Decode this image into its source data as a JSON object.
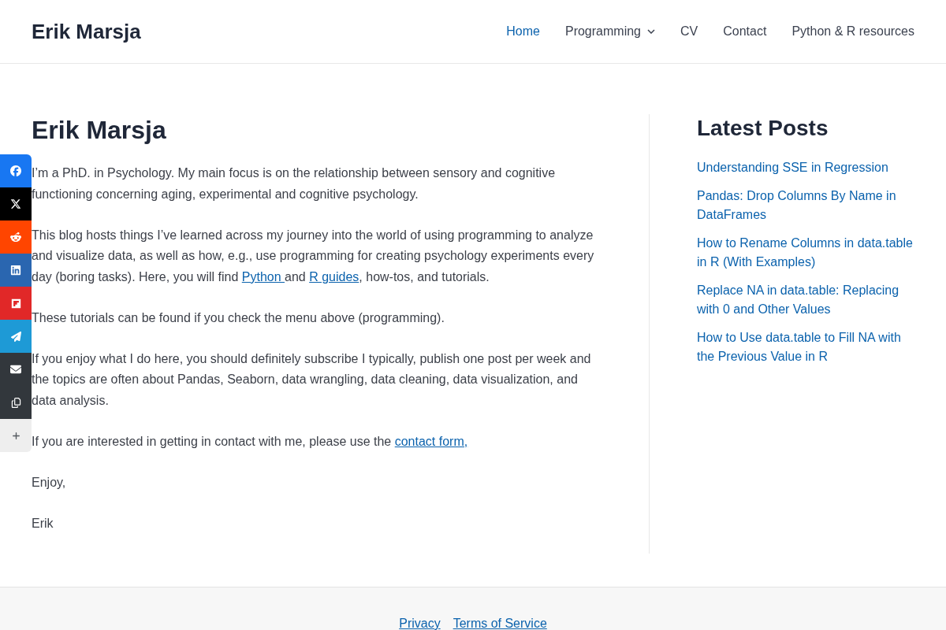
{
  "site_title": "Erik Marsja",
  "nav": [
    {
      "label": "Home",
      "selected": true,
      "has_submenu": false
    },
    {
      "label": "Programming",
      "selected": false,
      "has_submenu": true
    },
    {
      "label": "CV",
      "selected": false,
      "has_submenu": false
    },
    {
      "label": "Contact",
      "selected": false,
      "has_submenu": false
    },
    {
      "label": "Python & R resources",
      "selected": false,
      "has_submenu": false
    }
  ],
  "share_buttons": [
    {
      "kind": "facebook",
      "color": "#1877f2"
    },
    {
      "kind": "x",
      "color": "#000000"
    },
    {
      "kind": "reddit",
      "color": "#ff4500"
    },
    {
      "kind": "linkedin",
      "color": "#2a66b0"
    },
    {
      "kind": "flipboard",
      "color": "#e12828"
    },
    {
      "kind": "telegram",
      "color": "#1e9ad6"
    },
    {
      "kind": "email",
      "color": "#32373c"
    },
    {
      "kind": "copy",
      "color": "#32373c"
    },
    {
      "kind": "more",
      "color": "#eeeeee"
    }
  ],
  "page": {
    "title": "Erik Marsja",
    "paragraphs": [
      [
        {
          "kind": "text",
          "text": "I’m a PhD. in Psychology. My main focus is on the relationship between sensory and cognitive functioning concerning aging, experimental and cognitive psychology."
        }
      ],
      [
        {
          "kind": "text",
          "text": "This blog hosts things I’ve learned across my journey into the world of using programming to analyze and visualize data, as well as how, e.g., use programming for creating psychology experiments every day (boring tasks). Here, you will find "
        },
        {
          "kind": "link",
          "text": "Python "
        },
        {
          "kind": "text",
          "text": "and "
        },
        {
          "kind": "link",
          "text": "R guides"
        },
        {
          "kind": "text",
          "text": ", how-tos, and tutorials."
        }
      ],
      [
        {
          "kind": "text",
          "text": "These tutorials can be found if you check the menu above (programming)."
        }
      ],
      [
        {
          "kind": "text",
          "text": "If you enjoy what I do here, you should definitely subscribe I typically, publish one post per week and the topics are often about Pandas, Seaborn, data wrangling, data cleaning, data visualization, and data analysis."
        }
      ],
      [
        {
          "kind": "text",
          "text": "If you are interested in getting in contact with me, please use the "
        },
        {
          "kind": "link",
          "text": "contact form,"
        }
      ],
      [
        {
          "kind": "text",
          "text": "Enjoy,"
        }
      ],
      [
        {
          "kind": "text",
          "text": "Erik"
        }
      ]
    ]
  },
  "sidebar": {
    "title": "Latest Posts",
    "posts": [
      "Understanding SSE in Regression",
      "Pandas: Drop Columns By Name in DataFrames",
      "How to Rename Columns in data.table in R (With Examples)",
      "Replace NA in data.table: Replacing with 0 and Other Values",
      "How to Use data.table to Fill NA with the Previous Value in R"
    ]
  },
  "footer": {
    "links": [
      "Privacy",
      "Terms of Service"
    ]
  }
}
